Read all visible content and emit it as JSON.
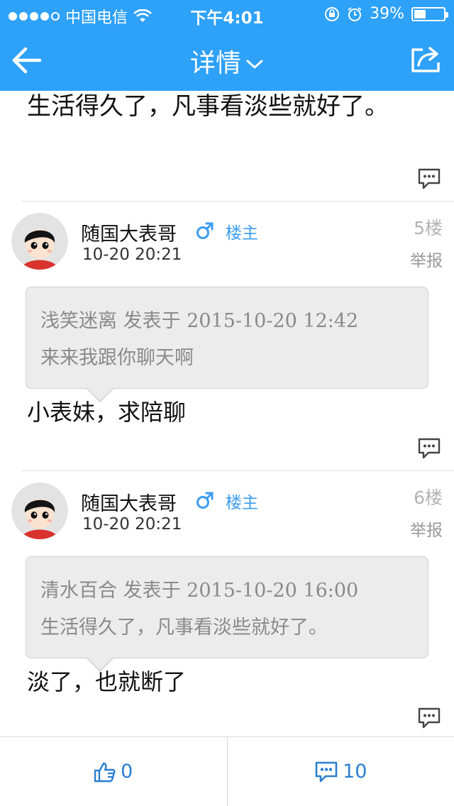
{
  "status_bar": {
    "carrier": "中国电信",
    "time": "下午4:01",
    "battery": "39%",
    "battery_level": 0.39,
    "signal_dots_filled": 4
  },
  "nav": {
    "title": "详情",
    "back_icon": "arrow-left-icon",
    "share_icon": "share-icon"
  },
  "previous_post_tail": "生活得久了，凡事看淡些就好了。",
  "posts": [
    {
      "author": "随国大表哥",
      "owner_badge": "楼主",
      "time": "10-20 20:21",
      "floor": "5楼",
      "report": "举报",
      "quote_header": "浅笑迷离 发表于 2015-10-20 12:42",
      "quote_text": "来来我跟你聊天啊",
      "text": "小表妹，求陪聊"
    },
    {
      "author": "随国大表哥",
      "owner_badge": "楼主",
      "time": "10-20 20:21",
      "floor": "6楼",
      "report": "举报",
      "quote_header": "清水百合 发表于 2015-10-20 16:00",
      "quote_text": "生活得久了，凡事看淡些就好了。",
      "text": "淡了，也就断了"
    }
  ],
  "bottom_bar": {
    "like_count": "0",
    "comment_count": "10"
  },
  "colors": {
    "header": "#2ea1f8",
    "owner_badge": "#3b9cf2",
    "bottom_icons": "#2a7fd0"
  }
}
